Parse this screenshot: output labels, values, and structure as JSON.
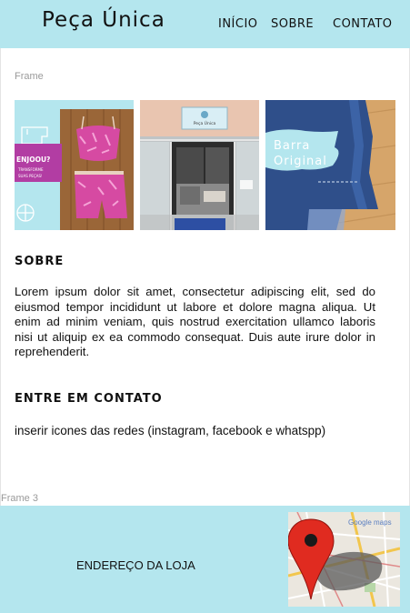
{
  "header": {
    "brand": "Peça Única",
    "nav": [
      {
        "label": "INÍCIO"
      },
      {
        "label": "SOBRE"
      },
      {
        "label": "CONTATO"
      }
    ]
  },
  "frames": {
    "top_label": "Frame",
    "footer_label": "Frame 3"
  },
  "gallery": {
    "tile1": {
      "line1": "ENJOOU?",
      "line2": "TRANSFORME",
      "line3": "SUAS PEÇAS!"
    },
    "tile2": {
      "sign": "Peça Única"
    },
    "tile3": {
      "line1": "Barra",
      "line2": "Original"
    }
  },
  "sobre": {
    "title": "SOBRE",
    "text": "Lorem ipsum dolor sit amet, consectetur adipiscing elit, sed do eiusmod tempor incididunt ut labore et dolore magna aliqua. Ut enim ad minim veniam, quis nostrud exercitation ullamco laboris nisi ut aliquip ex ea commodo consequat. Duis aute irure dolor in reprehenderit."
  },
  "contato": {
    "title": "ENTRE EM CONTATO",
    "text": "inserir icones das redes (instagram, facebook e whatspp)"
  },
  "footer": {
    "address": "ENDEREÇO DA LOJA",
    "map_brand": "Google maps"
  },
  "colors": {
    "accent": "#b4e6ee",
    "pin": "#e02b20"
  },
  "icons": {
    "map_pin": "map-pin-icon",
    "sewing_machine": "sewing-machine-icon"
  }
}
